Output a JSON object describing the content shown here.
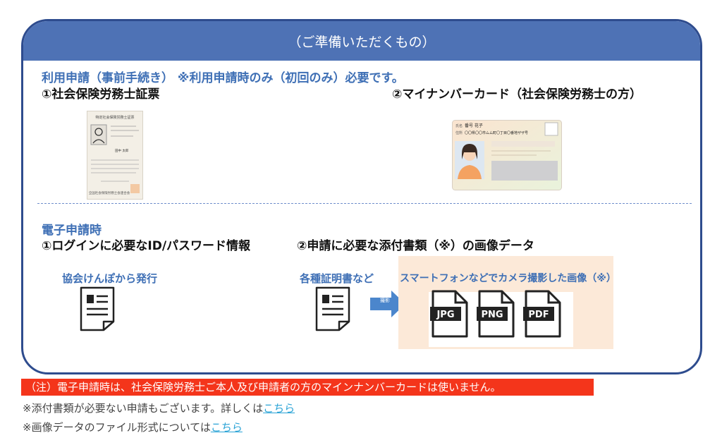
{
  "header": {
    "title": "（ご準備いただくもの）"
  },
  "section1": {
    "title": "利用申請（事前手続き） ※利用申請時のみ（初回のみ）必要です。",
    "item1": "①社会保険労務士証票",
    "item2": "②マイナンバーカード（社会保険労務士の方）",
    "card1": {
      "title": "特定社会保険労務士証票",
      "footer": "全国社会保険労務士会連合会",
      "name": "田中 太郎"
    },
    "card2": {
      "name_label": "氏名",
      "name": "番号 花子",
      "addr_label": "住所",
      "addr": "〇〇県〇〇市ムム町〇丁目〇番地ザザ号"
    }
  },
  "section2": {
    "title": "電子申請時",
    "item1": "①ログインに必要なID/パスワード情報",
    "item2": "②申請に必要な添付書類（※）の画像データ",
    "note1": "協会けんぽから発行",
    "note2": "各種証明書など",
    "arrow_label": "撮影",
    "note3": "スマートフォンなどでカメラ撮影した画像（※）",
    "formats": [
      "JPG",
      "PNG",
      "PDF"
    ]
  },
  "warning": "（注）電子申請時は、社会保険労務士ご本人及び申請者の方のマインナンバーカードは使いません。",
  "footnotes": [
    {
      "text": "※添付書類が必要ない申請もございます。詳しくは",
      "link": "こちら"
    },
    {
      "text": "※画像データのファイル形式については",
      "link": "こちら"
    }
  ],
  "colors": {
    "frame": "#2e4c8e",
    "header": "#4e72b5",
    "accent": "#3e6fb5",
    "warning": "#f4351b",
    "link": "#2aa3d6",
    "peach": "#fce9d8"
  }
}
